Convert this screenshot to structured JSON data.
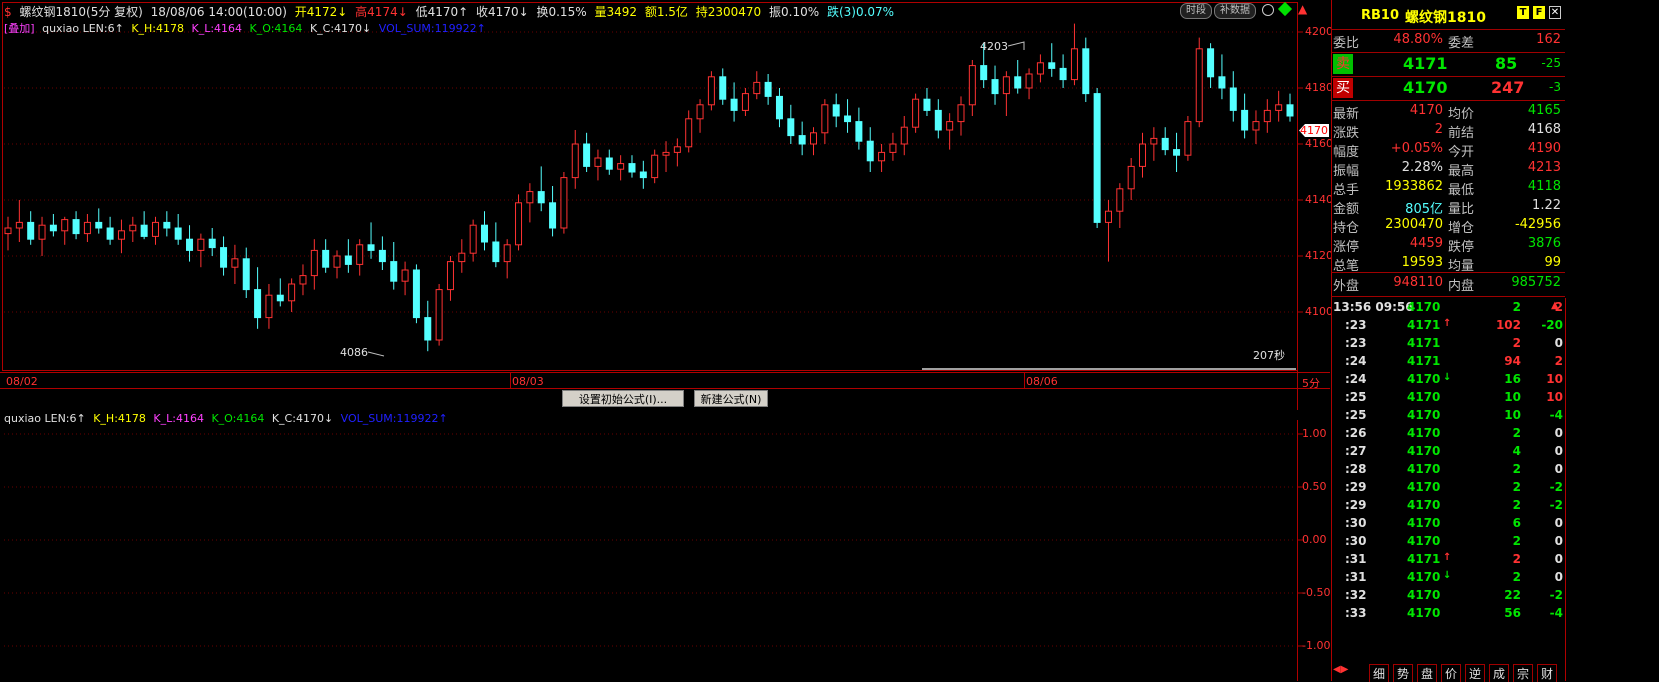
{
  "info_bar": {
    "title": "螺纹钢1810(5分 复权)",
    "datetime": "18/08/06 14:00(10:00)",
    "open": "开4172↓",
    "high": "高4174↓",
    "low": "低4170↑",
    "close": "收4170↓",
    "turnover": "换0.15%",
    "volume": "量3492",
    "amount": "额1.5亿",
    "hold": "持2300470",
    "amplitude": "振0.10%",
    "change": "跌(3)0.07%"
  },
  "top_buttons": {
    "timeshare": "时段",
    "supplement": "补数据"
  },
  "indicator_main": {
    "overlay_tag": "[叠加]",
    "name": "quxiao LEN:6↑",
    "kh": "K_H:4178",
    "kl": "K_L:4164",
    "ko": "K_O:4164",
    "kc": "K_C:4170↓",
    "vol": "VOL_SUM:119922↑"
  },
  "indicator_sub": {
    "name": "quxiao LEN:6↑",
    "kh": "K_H:4178",
    "kl": "K_L:4164",
    "ko": "K_O:4164",
    "kc": "K_C:4170↓",
    "vol": "VOL_SUM:119922↑"
  },
  "price_axis": [
    "4200",
    "4180",
    "4160",
    "4140",
    "4120",
    "4100"
  ],
  "current_price_tag": "4170",
  "annotations": {
    "high_label": "4203",
    "low_label": "4086",
    "countdown": "207秒"
  },
  "date_axis": [
    "08/02",
    "08/03",
    "08/06"
  ],
  "period_label": "5分",
  "formula_buttons": {
    "init": "设置初始公式(I)...",
    "new": "新建公式(N)"
  },
  "sub_axis": [
    "1.00",
    "0.50",
    "0.00",
    "-0.50",
    "-1.00"
  ],
  "chart_data": {
    "type": "candlestick",
    "ylim": [
      4080,
      4210
    ],
    "candles": [
      [
        4128,
        4134,
        4122,
        4130
      ],
      [
        4130,
        4140,
        4125,
        4132
      ],
      [
        4132,
        4136,
        4124,
        4126
      ],
      [
        4126,
        4134,
        4120,
        4131
      ],
      [
        4131,
        4135,
        4127,
        4129
      ],
      [
        4129,
        4134,
        4124,
        4133
      ],
      [
        4133,
        4136,
        4126,
        4128
      ],
      [
        4128,
        4135,
        4125,
        4132
      ],
      [
        4132,
        4137,
        4128,
        4130
      ],
      [
        4130,
        4134,
        4124,
        4126
      ],
      [
        4126,
        4133,
        4121,
        4129
      ],
      [
        4129,
        4134,
        4125,
        4131
      ],
      [
        4131,
        4136,
        4126,
        4127
      ],
      [
        4127,
        4134,
        4124,
        4132
      ],
      [
        4132,
        4136,
        4127,
        4130
      ],
      [
        4130,
        4135,
        4124,
        4126
      ],
      [
        4126,
        4131,
        4118,
        4122
      ],
      [
        4122,
        4128,
        4116,
        4126
      ],
      [
        4126,
        4130,
        4120,
        4123
      ],
      [
        4123,
        4127,
        4113,
        4116
      ],
      [
        4116,
        4124,
        4110,
        4119
      ],
      [
        4119,
        4123,
        4105,
        4108
      ],
      [
        4108,
        4116,
        4094,
        4098
      ],
      [
        4098,
        4110,
        4094,
        4106
      ],
      [
        4106,
        4112,
        4102,
        4104
      ],
      [
        4104,
        4112,
        4100,
        4110
      ],
      [
        4110,
        4117,
        4106,
        4113
      ],
      [
        4113,
        4126,
        4108,
        4122
      ],
      [
        4122,
        4126,
        4114,
        4116
      ],
      [
        4116,
        4122,
        4112,
        4120
      ],
      [
        4120,
        4126,
        4114,
        4117
      ],
      [
        4117,
        4126,
        4113,
        4124
      ],
      [
        4124,
        4132,
        4119,
        4122
      ],
      [
        4122,
        4127,
        4115,
        4118
      ],
      [
        4118,
        4125,
        4108,
        4111
      ],
      [
        4111,
        4118,
        4106,
        4115
      ],
      [
        4115,
        4117,
        4096,
        4098
      ],
      [
        4098,
        4104,
        4086,
        4090
      ],
      [
        4090,
        4110,
        4088,
        4108
      ],
      [
        4108,
        4120,
        4104,
        4118
      ],
      [
        4118,
        4126,
        4114,
        4121
      ],
      [
        4121,
        4133,
        4118,
        4131
      ],
      [
        4131,
        4136,
        4122,
        4125
      ],
      [
        4125,
        4132,
        4116,
        4118
      ],
      [
        4118,
        4126,
        4112,
        4124
      ],
      [
        4124,
        4142,
        4122,
        4139
      ],
      [
        4139,
        4146,
        4132,
        4143
      ],
      [
        4143,
        4152,
        4136,
        4139
      ],
      [
        4139,
        4145,
        4127,
        4130
      ],
      [
        4130,
        4150,
        4128,
        4148
      ],
      [
        4148,
        4165,
        4144,
        4160
      ],
      [
        4160,
        4164,
        4150,
        4152
      ],
      [
        4152,
        4158,
        4147,
        4155
      ],
      [
        4155,
        4158,
        4149,
        4151
      ],
      [
        4151,
        4156,
        4147,
        4153
      ],
      [
        4153,
        4156,
        4148,
        4150
      ],
      [
        4150,
        4154,
        4144,
        4148
      ],
      [
        4148,
        4158,
        4146,
        4156
      ],
      [
        4156,
        4161,
        4150,
        4157
      ],
      [
        4157,
        4162,
        4152,
        4159
      ],
      [
        4159,
        4172,
        4157,
        4169
      ],
      [
        4169,
        4176,
        4164,
        4174
      ],
      [
        4174,
        4186,
        4172,
        4184
      ],
      [
        4184,
        4187,
        4174,
        4176
      ],
      [
        4176,
        4182,
        4168,
        4172
      ],
      [
        4172,
        4180,
        4170,
        4178
      ],
      [
        4178,
        4186,
        4176,
        4182
      ],
      [
        4182,
        4185,
        4174,
        4177
      ],
      [
        4177,
        4180,
        4166,
        4169
      ],
      [
        4169,
        4174,
        4160,
        4163
      ],
      [
        4163,
        4168,
        4156,
        4160
      ],
      [
        4160,
        4166,
        4156,
        4164
      ],
      [
        4164,
        4176,
        4160,
        4174
      ],
      [
        4174,
        4178,
        4166,
        4170
      ],
      [
        4170,
        4176,
        4164,
        4168
      ],
      [
        4168,
        4173,
        4158,
        4161
      ],
      [
        4161,
        4166,
        4150,
        4154
      ],
      [
        4154,
        4160,
        4150,
        4157
      ],
      [
        4157,
        4164,
        4154,
        4160
      ],
      [
        4160,
        4170,
        4156,
        4166
      ],
      [
        4166,
        4178,
        4164,
        4176
      ],
      [
        4176,
        4180,
        4170,
        4172
      ],
      [
        4172,
        4176,
        4162,
        4165
      ],
      [
        4165,
        4171,
        4158,
        4168
      ],
      [
        4168,
        4177,
        4163,
        4174
      ],
      [
        4174,
        4190,
        4170,
        4188
      ],
      [
        4188,
        4196,
        4180,
        4183
      ],
      [
        4183,
        4188,
        4174,
        4178
      ],
      [
        4178,
        4186,
        4170,
        4184
      ],
      [
        4184,
        4190,
        4178,
        4180
      ],
      [
        4180,
        4187,
        4176,
        4185
      ],
      [
        4185,
        4192,
        4182,
        4189
      ],
      [
        4189,
        4196,
        4184,
        4187
      ],
      [
        4187,
        4192,
        4180,
        4183
      ],
      [
        4183,
        4203,
        4181,
        4194
      ],
      [
        4194,
        4198,
        4175,
        4178
      ],
      [
        4178,
        4180,
        4130,
        4132
      ],
      [
        4132,
        4140,
        4118,
        4136
      ],
      [
        4136,
        4146,
        4130,
        4144
      ],
      [
        4144,
        4155,
        4140,
        4152
      ],
      [
        4152,
        4164,
        4148,
        4160
      ],
      [
        4160,
        4166,
        4154,
        4162
      ],
      [
        4162,
        4166,
        4156,
        4158
      ],
      [
        4158,
        4164,
        4150,
        4156
      ],
      [
        4156,
        4170,
        4154,
        4168
      ],
      [
        4168,
        4198,
        4166,
        4194
      ],
      [
        4194,
        4196,
        4180,
        4184
      ],
      [
        4184,
        4192,
        4176,
        4180
      ],
      [
        4180,
        4186,
        4168,
        4172
      ],
      [
        4172,
        4178,
        4162,
        4165
      ],
      [
        4165,
        4172,
        4160,
        4168
      ],
      [
        4168,
        4176,
        4164,
        4172
      ],
      [
        4172,
        4179,
        4168,
        4174
      ],
      [
        4174,
        4178,
        4168,
        4170
      ]
    ]
  },
  "panel": {
    "code": "RB10",
    "name": "螺纹钢1810",
    "weibi_label": "委比",
    "weibi_value": "48.80%",
    "weicha_label": "委差",
    "weicha_value": "162",
    "sell_label": "卖",
    "sell_price": "4171",
    "sell_vol": "85",
    "sell_chg": "-25",
    "buy_label": "买",
    "buy_price": "4170",
    "buy_vol": "247",
    "buy_chg": "-3",
    "stats": [
      {
        "l1": "最新",
        "v1": "4170",
        "c1": "red",
        "l2": "均价",
        "v2": "4165",
        "c2": "green"
      },
      {
        "l1": "涨跌",
        "v1": "2",
        "c1": "red",
        "l2": "前结",
        "v2": "4168",
        "c2": "white"
      },
      {
        "l1": "幅度",
        "v1": "+0.05%",
        "c1": "red",
        "l2": "今开",
        "v2": "4190",
        "c2": "red"
      },
      {
        "l1": "振幅",
        "v1": "2.28%",
        "c1": "white",
        "l2": "最高",
        "v2": "4213",
        "c2": "red"
      },
      {
        "l1": "总手",
        "v1": "1933862",
        "c1": "yellow",
        "l2": "最低",
        "v2": "4118",
        "c2": "green"
      },
      {
        "l1": "金额",
        "v1": "805亿",
        "c1": "cyan",
        "l2": "量比",
        "v2": "1.22",
        "c2": "white"
      },
      {
        "l1": "持仓",
        "v1": "2300470",
        "c1": "yellow",
        "l2": "增仓",
        "v2": "-42956",
        "c2": "yellow"
      },
      {
        "l1": "涨停",
        "v1": "4459",
        "c1": "red",
        "l2": "跌停",
        "v2": "3876",
        "c2": "green"
      },
      {
        "l1": "总笔",
        "v1": "19593",
        "c1": "yellow",
        "l2": "均量",
        "v2": "99",
        "c2": "yellow"
      }
    ],
    "outer_label": "外盘",
    "outer_value": "948110",
    "inner_label": "内盘",
    "inner_value": "985752",
    "ticks": [
      {
        "t": "13:56 09:56",
        "p": "4170",
        "pc": "green",
        "a": "",
        "ac": "green",
        "v": "2",
        "vc": "green",
        "d": "2",
        "dc": "red"
      },
      {
        "t": ":23",
        "p": "4171",
        "pc": "green",
        "a": "↑",
        "ac": "red",
        "v": "102",
        "vc": "red",
        "d": "-20",
        "dc": "green"
      },
      {
        "t": ":23",
        "p": "4171",
        "pc": "green",
        "a": "",
        "ac": "red",
        "v": "2",
        "vc": "red",
        "d": "0",
        "dc": "white"
      },
      {
        "t": ":24",
        "p": "4171",
        "pc": "green",
        "a": "",
        "ac": "red",
        "v": "94",
        "vc": "red",
        "d": "2",
        "dc": "red"
      },
      {
        "t": ":24",
        "p": "4170",
        "pc": "green",
        "a": "↓",
        "ac": "green",
        "v": "16",
        "vc": "green",
        "d": "10",
        "dc": "red"
      },
      {
        "t": ":25",
        "p": "4170",
        "pc": "green",
        "a": "",
        "ac": "green",
        "v": "10",
        "vc": "green",
        "d": "10",
        "dc": "red"
      },
      {
        "t": ":25",
        "p": "4170",
        "pc": "green",
        "a": "",
        "ac": "green",
        "v": "10",
        "vc": "green",
        "d": "-4",
        "dc": "green"
      },
      {
        "t": ":26",
        "p": "4170",
        "pc": "green",
        "a": "",
        "ac": "green",
        "v": "2",
        "vc": "green",
        "d": "0",
        "dc": "white"
      },
      {
        "t": ":27",
        "p": "4170",
        "pc": "green",
        "a": "",
        "ac": "green",
        "v": "4",
        "vc": "green",
        "d": "0",
        "dc": "white"
      },
      {
        "t": ":28",
        "p": "4170",
        "pc": "green",
        "a": "",
        "ac": "green",
        "v": "2",
        "vc": "green",
        "d": "0",
        "dc": "white"
      },
      {
        "t": ":29",
        "p": "4170",
        "pc": "green",
        "a": "",
        "ac": "green",
        "v": "2",
        "vc": "green",
        "d": "-2",
        "dc": "green"
      },
      {
        "t": ":29",
        "p": "4170",
        "pc": "green",
        "a": "",
        "ac": "green",
        "v": "2",
        "vc": "green",
        "d": "-2",
        "dc": "green"
      },
      {
        "t": ":30",
        "p": "4170",
        "pc": "green",
        "a": "",
        "ac": "green",
        "v": "6",
        "vc": "green",
        "d": "0",
        "dc": "white"
      },
      {
        "t": ":30",
        "p": "4170",
        "pc": "green",
        "a": "",
        "ac": "green",
        "v": "2",
        "vc": "green",
        "d": "0",
        "dc": "white"
      },
      {
        "t": ":31",
        "p": "4171",
        "pc": "green",
        "a": "↑",
        "ac": "red",
        "v": "2",
        "vc": "red",
        "d": "0",
        "dc": "white"
      },
      {
        "t": ":31",
        "p": "4170",
        "pc": "green",
        "a": "↓",
        "ac": "green",
        "v": "2",
        "vc": "green",
        "d": "0",
        "dc": "white"
      },
      {
        "t": ":32",
        "p": "4170",
        "pc": "green",
        "a": "",
        "ac": "green",
        "v": "22",
        "vc": "green",
        "d": "-2",
        "dc": "green"
      },
      {
        "t": ":33",
        "p": "4170",
        "pc": "green",
        "a": "",
        "ac": "green",
        "v": "56",
        "vc": "green",
        "d": "-4",
        "dc": "green"
      }
    ],
    "bottom_tabs": [
      "细",
      "势",
      "盘",
      "价",
      "逆",
      "成",
      "宗",
      "财"
    ]
  }
}
